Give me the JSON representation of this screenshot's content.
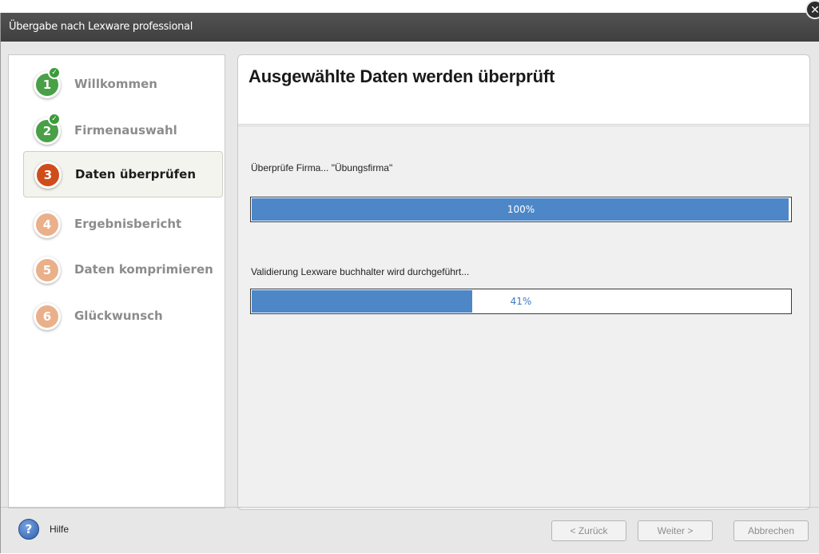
{
  "window": {
    "title": "Übergabe nach Lexware professional"
  },
  "steps": [
    {
      "number": "1",
      "label": "Willkommen",
      "state": "done"
    },
    {
      "number": "2",
      "label": "Firmenauswahl",
      "state": "done"
    },
    {
      "number": "3",
      "label": "Daten überprüfen",
      "state": "current"
    },
    {
      "number": "4",
      "label": "Ergebnisbericht",
      "state": "pending"
    },
    {
      "number": "5",
      "label": "Daten komprimieren",
      "state": "pending"
    },
    {
      "number": "6",
      "label": "Glückwunsch",
      "state": "pending"
    }
  ],
  "content": {
    "heading": "Ausgewählte Daten werden überprüft",
    "tasks": [
      {
        "text": "Überprüfe Firma... \"Übungsfirma\"",
        "progress_label": "100%",
        "progress": 1.0
      },
      {
        "text": "Validierung Lexware buchhalter wird durchgeführt...",
        "progress_label": "41%",
        "progress": 0.41
      }
    ]
  },
  "footer": {
    "help_label": "Hilfe",
    "back_label": "< Zurück",
    "next_label": "Weiter >",
    "cancel_label": "Abbrechen"
  },
  "colors": {
    "titlebar": "#4a4a4a",
    "step_done": "#49a047",
    "step_current": "#cf4d1a",
    "step_pending": "#eab08a",
    "progress_fill": "#4d87c7"
  }
}
